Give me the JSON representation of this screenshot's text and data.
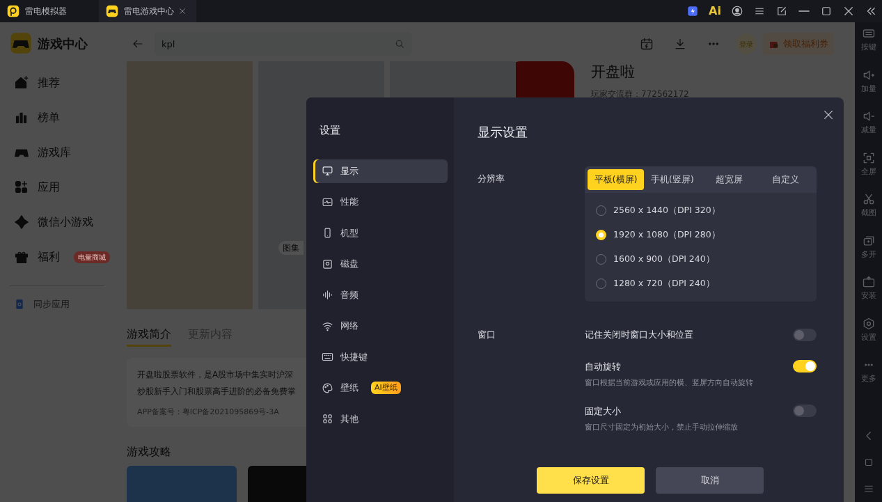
{
  "title_bar": {
    "tabs": [
      {
        "label": "雷电模拟器",
        "selected": false
      },
      {
        "label": "雷电游戏中心",
        "selected": true
      }
    ],
    "ai_logo": "Ai"
  },
  "sidebar": {
    "title": "游戏中心",
    "items": [
      {
        "label": "推荐"
      },
      {
        "label": "榜单"
      },
      {
        "label": "游戏库"
      },
      {
        "label": "应用"
      },
      {
        "label": "微信小游戏"
      },
      {
        "label": "福利",
        "badge": "电量商城"
      }
    ],
    "sync": "同步应用"
  },
  "search": {
    "value": "kpl"
  },
  "header_actions": {
    "login": "登录",
    "coupon": "领取福利券"
  },
  "gallery": {
    "tag": "图集"
  },
  "app": {
    "name": "开盘啦",
    "group": "玩家交流群：772562172"
  },
  "detail_tabs": [
    {
      "label": "游戏简介",
      "selected": true
    },
    {
      "label": "更新内容",
      "selected": false
    }
  ],
  "description": {
    "lines": [
      "开盘啦股票软件，是A股市场中集实时沪深",
      "炒股新手入门和股票高手进阶的必备免费掌"
    ],
    "record": "APP备案号：粤ICP备2021095869号-3A"
  },
  "guides": {
    "title": "游戏攻略"
  },
  "right_toolbar": {
    "items": [
      {
        "label": "按键"
      },
      {
        "label": "加量"
      },
      {
        "label": "减量"
      },
      {
        "label": "全屏"
      },
      {
        "label": "截图"
      },
      {
        "label": "多开"
      },
      {
        "label": "安装"
      },
      {
        "label": "设置"
      },
      {
        "label": "更多"
      }
    ]
  },
  "settings": {
    "title": "设置",
    "nav": [
      {
        "label": "显示",
        "selected": true
      },
      {
        "label": "性能",
        "selected": false
      },
      {
        "label": "机型",
        "selected": false
      },
      {
        "label": "磁盘",
        "selected": false
      },
      {
        "label": "音频",
        "selected": false
      },
      {
        "label": "网络",
        "selected": false
      },
      {
        "label": "快捷键",
        "selected": false
      },
      {
        "label": "壁纸",
        "selected": false,
        "badge": "AI壁纸"
      },
      {
        "label": "其他",
        "selected": false
      }
    ],
    "heading": "显示设置",
    "resolution": {
      "label": "分辨率",
      "tabs": [
        {
          "label": "平板(横屏)",
          "selected": true
        },
        {
          "label": "手机(竖屏)",
          "selected": false
        },
        {
          "label": "超宽屏",
          "selected": false
        },
        {
          "label": "自定义",
          "selected": false
        }
      ],
      "options": [
        {
          "label": "2560 x 1440（DPI 320）",
          "selected": false
        },
        {
          "label": "1920 x 1080（DPI 280）",
          "selected": true
        },
        {
          "label": "1600 x 900（DPI 240）",
          "selected": false
        },
        {
          "label": "1280 x 720（DPI 240）",
          "selected": false
        }
      ]
    },
    "window": {
      "label": "窗口",
      "toggles": [
        {
          "label": "记住关闭时窗口大小和位置",
          "on": false
        },
        {
          "label": "自动旋转",
          "on": true,
          "hint": "窗口根据当前游戏或应用的横、竖屏方向自动旋转"
        },
        {
          "label": "固定大小",
          "on": false,
          "hint": "窗口尺寸固定为初始大小，禁止手动拉伸缩放"
        }
      ]
    },
    "buttons": {
      "save": "保存设置",
      "cancel": "取消"
    }
  }
}
